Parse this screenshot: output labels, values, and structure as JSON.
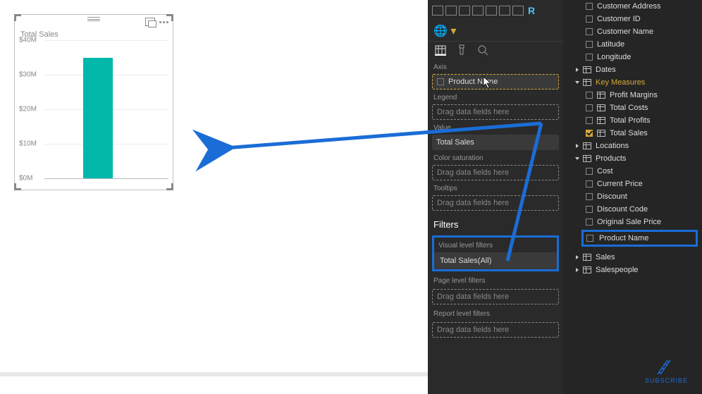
{
  "visual": {
    "title": "Total Sales"
  },
  "chart_data": {
    "type": "bar",
    "categories": [
      ""
    ],
    "values": [
      35000000
    ],
    "title": "Total Sales",
    "xlabel": "",
    "ylabel": "",
    "ylim": [
      0,
      40000000
    ],
    "y_ticks": [
      "$0M",
      "$10M",
      "$20M",
      "$30M",
      "$40M"
    ]
  },
  "viz_pane": {
    "r_label": "R",
    "wells": {
      "axis_label": "Axis",
      "axis_chip": "Product Name",
      "legend_label": "Legend",
      "legend_placeholder": "Drag data fields here",
      "value_label": "Value",
      "value_chip": "Total Sales",
      "color_label": "Color saturation",
      "color_placeholder": "Drag data fields here",
      "tooltips_label": "Tooltips",
      "tooltips_placeholder": "Drag data fields here"
    },
    "filters": {
      "header": "Filters",
      "visual_label": "Visual level filters",
      "visual_item": "Total Sales(All)",
      "page_label": "Page level filters",
      "page_placeholder": "Drag data fields here",
      "report_label": "Report level filters",
      "report_placeholder": "Drag data fields here"
    }
  },
  "fields": {
    "customers": {
      "address": "Customer Address",
      "id": "Customer ID",
      "name": "Customer Name",
      "latitude": "Latitude",
      "longitude": "Longitude"
    },
    "dates_label": "Dates",
    "key_measures": {
      "label": "Key Measures",
      "profit_margins": "Profit Margins",
      "total_costs": "Total Costs",
      "total_profits": "Total Profits",
      "total_sales": "Total Sales"
    },
    "locations_label": "Locations",
    "products": {
      "label": "Products",
      "cost": "Cost",
      "current_price": "Current Price",
      "discount": "Discount",
      "discount_code": "Discount Code",
      "original_sale_price": "Original Sale Price",
      "product_name": "Product Name"
    },
    "sales_label": "Sales",
    "salespeople_label": "Salespeople"
  },
  "subscribe_label": "SUBSCRIBE"
}
